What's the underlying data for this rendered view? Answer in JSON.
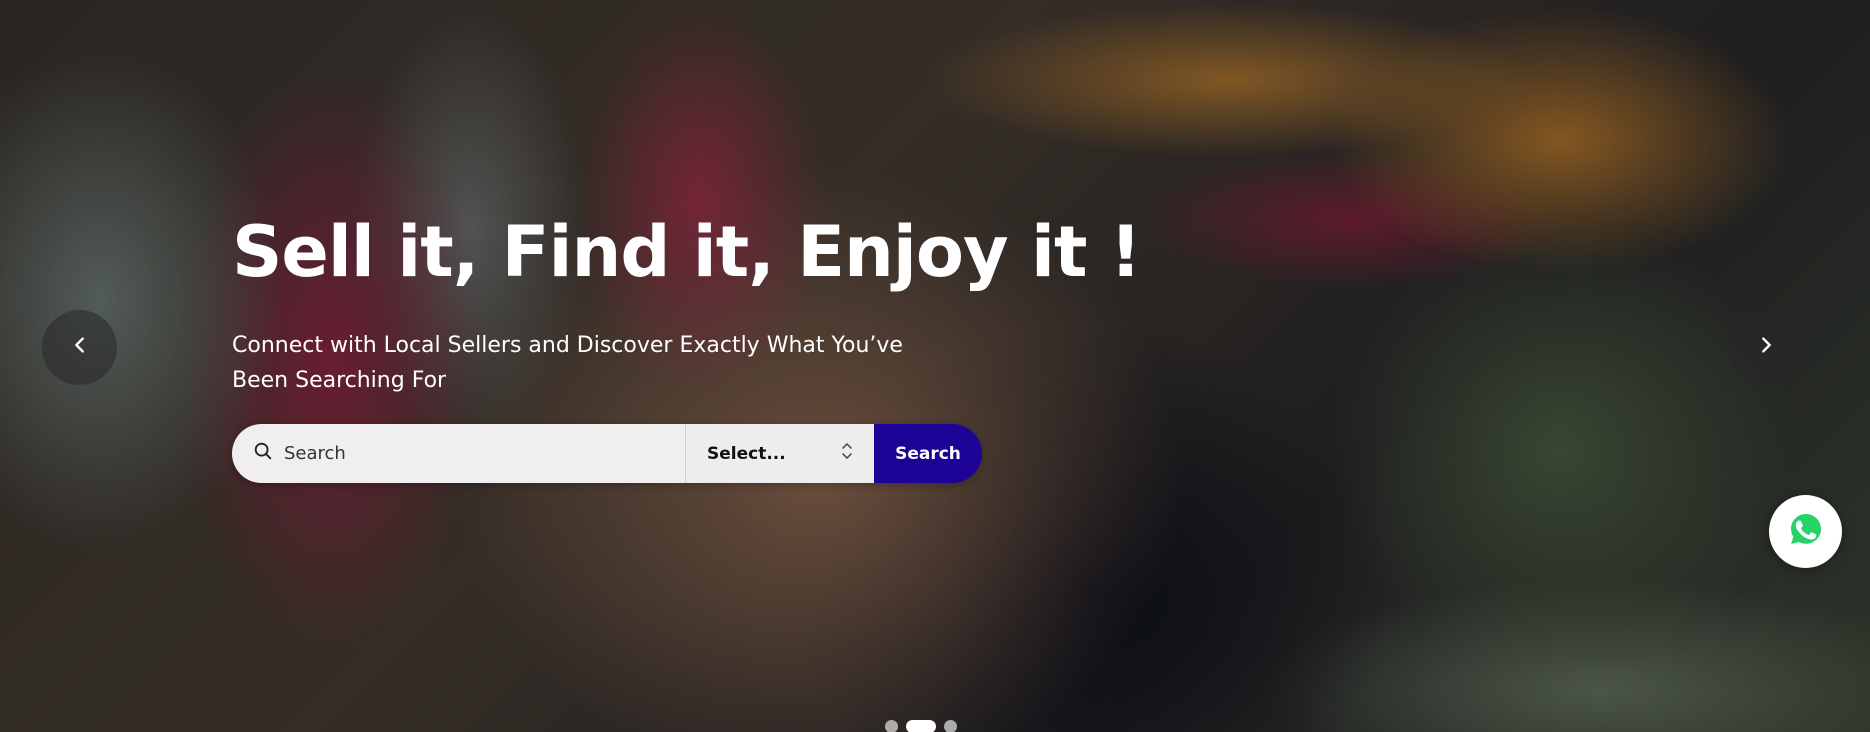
{
  "hero": {
    "headline": "Sell it, Find it, Enjoy it !",
    "subtitle": "Connect with Local Sellers and Discover Exactly What You’ve Been Searching For"
  },
  "search": {
    "placeholder": "Search",
    "value": "",
    "search_icon": "search-icon",
    "select_value": "Select...",
    "select_icon": "chevron-up-down-icon",
    "button_label": "Search",
    "button_color": "#1d0496"
  },
  "carousel": {
    "prev_icon": "chevron-left-icon",
    "next_icon": "chevron-right-icon",
    "slide_count": 3,
    "active_slide": 2
  },
  "whatsapp": {
    "icon": "whatsapp-icon",
    "color": "#25d366"
  }
}
